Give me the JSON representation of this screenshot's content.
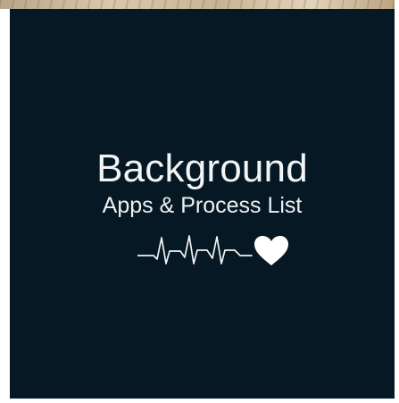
{
  "splash": {
    "title": "Background",
    "subtitle": "Apps & Process List",
    "logo_icon": "heartbeat-heart-icon"
  },
  "colors": {
    "background": "#051823",
    "text": "#f2f4f5",
    "accent": "#ffffff"
  }
}
